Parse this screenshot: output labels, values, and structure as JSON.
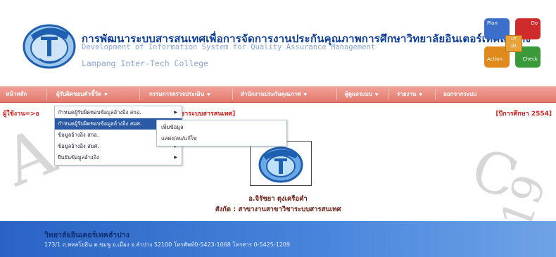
{
  "header": {
    "title_th": "การพัฒนาระบบสารสนเทศเพื่อการจัดการงานประกันคุณภาพการศึกษาวิทยาลัยอินเตอร์เทคลำปาง",
    "title_en": "Development of Information System for Quality Assurance Management",
    "college": "Lampang Inter-Tech College",
    "pdca": {
      "plan": "Plan",
      "do": "Do",
      "action": "Action",
      "check": "Check",
      "center_top": "LIT",
      "center_bottom": "QA"
    }
  },
  "colors": {
    "nav": "#e3786c",
    "footer": "#2a63c4",
    "title": "#0f3e9a",
    "user": "#d5201c",
    "menu_selected": "#2b5aa5"
  },
  "icons": {
    "logo": "college-logo-icon",
    "submenu_arrow": "triangle-right-icon",
    "nav_arrow": "chevron-down-icon"
  },
  "nav": {
    "items": [
      {
        "label": "หน้าหลัก",
        "has_arrow": false
      },
      {
        "label": "ผู้รับผิดชอบตัวชี้วัด",
        "has_arrow": true
      },
      {
        "label": "กรรมการตรวจประเมิน",
        "has_arrow": true
      },
      {
        "label": "สำนักงานประกันคุณภาพ",
        "has_arrow": true
      },
      {
        "label": "ผู้ดูแลระบบ",
        "has_arrow": true
      },
      {
        "label": "รายงาน",
        "has_arrow": true
      },
      {
        "label": "ออกจากระบบ",
        "has_arrow": false
      }
    ],
    "arrow": "▼"
  },
  "userbar": {
    "left": "ผู้ใช้งาน=>อ",
    "mid": "าวิชาระบบสารสนเทศ]",
    "right": "[ปีการศึกษา  2554]"
  },
  "dropdown": {
    "items": [
      {
        "label": "กำหนดผู้รับผิดชอบข้อมูลอ้างอิง  สกอ.",
        "has_sub": true,
        "selected": false
      },
      {
        "label": "กำหนดผู้รับผิดชอบข้อมูลอ้างอิง  สมศ.",
        "has_sub": true,
        "selected": true
      },
      {
        "label": "ข้อมูลอ้างอิง  สกอ.",
        "has_sub": true,
        "selected": false
      },
      {
        "label": "ข้อมูลอ้างอิง  สมศ.",
        "has_sub": true,
        "selected": false
      },
      {
        "label": "ยืนยันข้อมูลอ้างอิง",
        "has_sub": true,
        "selected": false
      }
    ],
    "sub_arrow": "▶"
  },
  "submenu": {
    "items": [
      {
        "label": "เพิ่มข้อมูล"
      },
      {
        "label": "แสดง/ลบ/แก้ไข"
      }
    ]
  },
  "profile": {
    "name": "อ.จิรัชยา ตุงเครือคำ",
    "department": "สังกัด : สาขางานสาขาวิชาระบบสารสนเทศ"
  },
  "footer": {
    "name": "วิทยาลัยอินเตอร์เทคลำปาง",
    "address": "173/1 ถ.พหลโยธิน ต.ชมพู อ.เมือง จ.ลำปาง 52100 โทรศัพท์0-5423-1068 โทรสาร 0-5425-1209"
  }
}
